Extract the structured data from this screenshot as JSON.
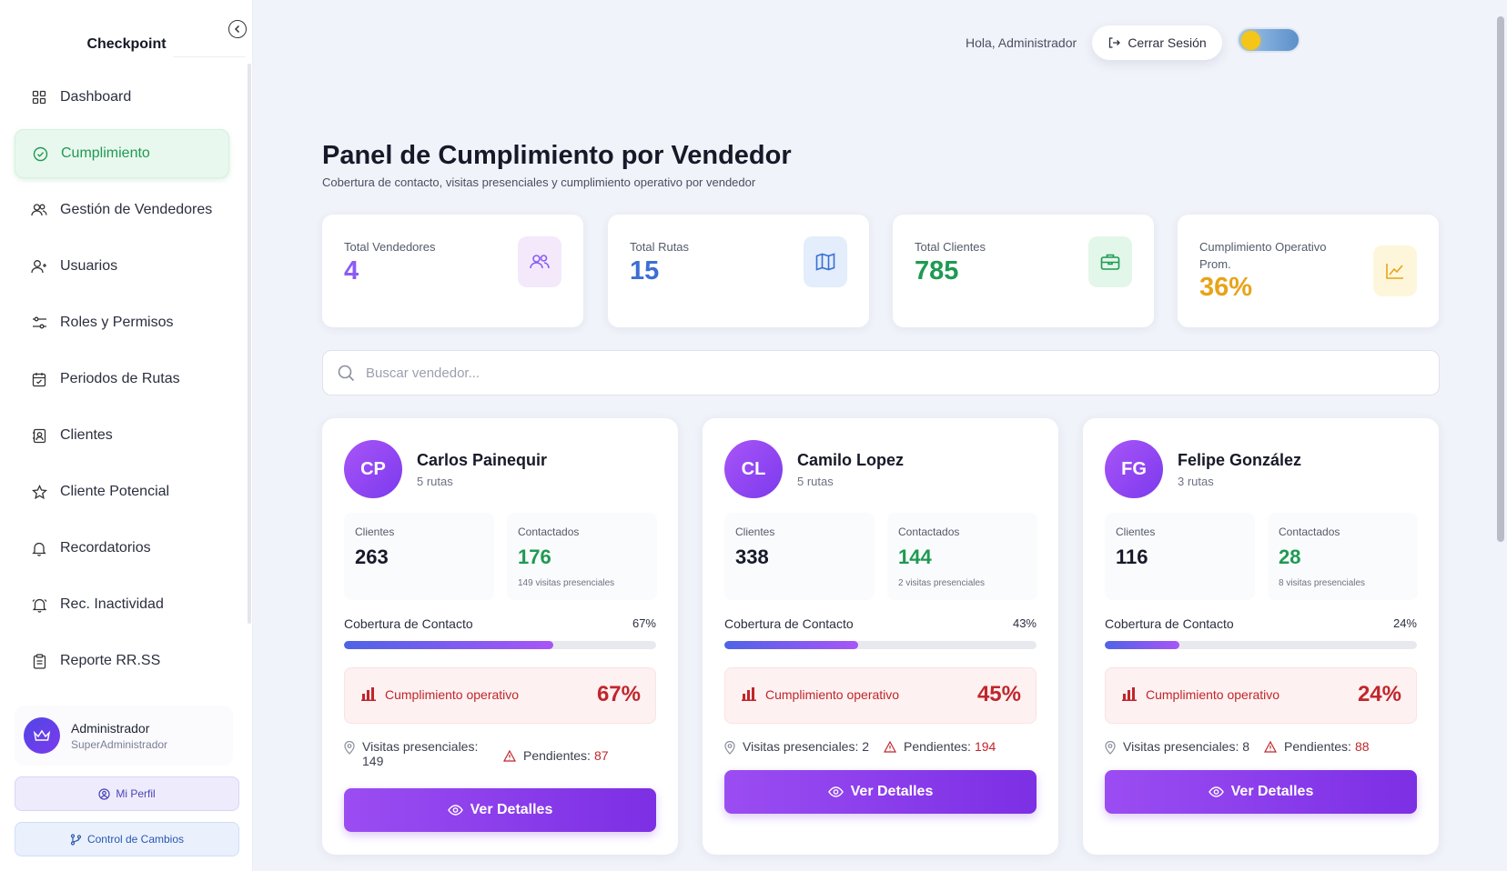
{
  "sidebar": {
    "brand": "Checkpoint",
    "items": [
      {
        "label": "Dashboard",
        "icon": "grid-icon"
      },
      {
        "label": "Cumplimiento",
        "icon": "check-circle-icon"
      },
      {
        "label": "Gestión de Vendedores",
        "icon": "users-icon"
      },
      {
        "label": "Usuarios",
        "icon": "user-icon"
      },
      {
        "label": "Roles y Permisos",
        "icon": "sliders-icon"
      },
      {
        "label": "Periodos de Rutas",
        "icon": "calendar-icon"
      },
      {
        "label": "Clientes",
        "icon": "contact-icon"
      },
      {
        "label": "Cliente Potencial",
        "icon": "star-icon"
      },
      {
        "label": "Recordatorios",
        "icon": "bell-icon"
      },
      {
        "label": "Rec. Inactividad",
        "icon": "bell-alert-icon"
      },
      {
        "label": "Reporte RR.SS",
        "icon": "clipboard-icon"
      }
    ],
    "active_item": "Cumplimiento",
    "user": {
      "name": "Administrador",
      "role": "SuperAdministrador"
    },
    "profile_button": "Mi Perfil",
    "changes_button": "Control de Cambios"
  },
  "header": {
    "greeting": "Hola, Administrador",
    "logout_label": "Cerrar Sesión"
  },
  "main": {
    "title": "Panel de Cumplimiento por Vendedor",
    "subtitle": "Cobertura de contacto, visitas presenciales y cumplimiento operativo por vendedor",
    "stats": [
      {
        "label": "Total Vendedores",
        "value": "4",
        "color": "#8b5cf6",
        "icon": "users-icon",
        "icon_bg": "#f3e9fb"
      },
      {
        "label": "Total Rutas",
        "value": "15",
        "color": "#3b6fd4",
        "icon": "map-icon",
        "icon_bg": "#e3edfb"
      },
      {
        "label": "Total Clientes",
        "value": "785",
        "color": "#1e9a52",
        "icon": "briefcase-icon",
        "icon_bg": "#e2f6e9"
      },
      {
        "label": "Cumplimiento Operativo Prom.",
        "value": "36%",
        "color": "#e8a317",
        "icon": "chart-line-icon",
        "icon_bg": "#fdf6da"
      }
    ],
    "search": {
      "placeholder": "Buscar vendedor..."
    },
    "vendors": [
      {
        "initials": "CP",
        "name": "Carlos Painequir",
        "routes": "5 rutas",
        "clients_label": "Clientes",
        "clients": "263",
        "contacted_label": "Contactados",
        "contacted": "176",
        "visits_sub": "149 visitas presenciales",
        "coverage_label": "Cobertura de Contacto",
        "coverage": "67%",
        "coverage_fraction": 0.67,
        "op_label": "Cumplimiento operativo",
        "op": "67%",
        "visits_label": "Visitas presenciales:",
        "visits": "149",
        "pending_label": "Pendientes:",
        "pending": "87",
        "button": "Ver Detalles"
      },
      {
        "initials": "CL",
        "name": "Camilo Lopez",
        "routes": "5 rutas",
        "clients_label": "Clientes",
        "clients": "338",
        "contacted_label": "Contactados",
        "contacted": "144",
        "visits_sub": "2 visitas presenciales",
        "coverage_label": "Cobertura de Contacto",
        "coverage": "43%",
        "coverage_fraction": 0.43,
        "op_label": "Cumplimiento operativo",
        "op": "45%",
        "visits_label": "Visitas presenciales:",
        "visits": "2",
        "pending_label": "Pendientes:",
        "pending": "194",
        "button": "Ver Detalles"
      },
      {
        "initials": "FG",
        "name": "Felipe González",
        "routes": "3 rutas",
        "clients_label": "Clientes",
        "clients": "116",
        "contacted_label": "Contactados",
        "contacted": "28",
        "visits_sub": "8 visitas presenciales",
        "coverage_label": "Cobertura de Contacto",
        "coverage": "24%",
        "coverage_fraction": 0.24,
        "op_label": "Cumplimiento operativo",
        "op": "24%",
        "visits_label": "Visitas presenciales:",
        "visits": "8",
        "pending_label": "Pendientes:",
        "pending": "88",
        "button": "Ver Detalles"
      }
    ]
  },
  "colors": {
    "accent_purple": "#8b3ef0",
    "active_green": "#1e9a52",
    "danger_red": "#c0262c"
  }
}
